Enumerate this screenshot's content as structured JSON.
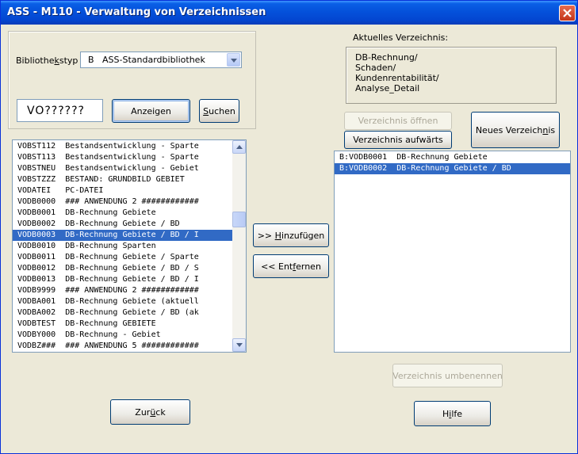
{
  "window": {
    "title": "ASS - M110 - Verwaltung von Verzeichnissen"
  },
  "library": {
    "label": "Bibliothekstyp",
    "label_pre": "Bibliothe",
    "label_acc": "k",
    "label_post": "styp",
    "selected": "B   ASS-Standardbibliothek"
  },
  "search": {
    "value": "VO??????",
    "show_button": "Anzeigen",
    "search_button": "Suchen",
    "search_acc": "S",
    "search_rest": "uchen"
  },
  "source_list": {
    "selected_index": 8,
    "items": [
      "VOBST112  Bestandsentwicklung - Sparte",
      "VOBST113  Bestandsentwicklung - Sparte",
      "VOBSTNEU  Bestandsentwicklung - Gebiet",
      "VOBSTZZZ  BESTAND: GRUNDBILD GEBIET",
      "VODATEI   PC-DATEI",
      "VODB0000  ### ANWENDUNG 2 ############",
      "VODB0001  DB-Rechnung Gebiete",
      "VODB0002  DB-Rechnung Gebiete / BD",
      "VODB0003  DB-Rechnung Gebiete / BD / I",
      "VODB0010  DB-Rechnung Sparten",
      "VODB0011  DB-Rechnung Gebiete / Sparte",
      "VODB0012  DB-Rechnung Gebiete / BD / S",
      "VODB0013  DB-Rechnung Gebiete / BD / I",
      "VODB9999  ### ANWENDUNG 2 ############",
      "VODBA001  DB-Rechnung Gebiete (aktuell",
      "VODBA002  DB-Rechnung Gebiete / BD (ak",
      "VODBTEST  DB-Rechnung GEBIETE",
      "VODBY000  DB-Rechnung - Gebiet",
      "VODBZ###  ### ANWENDUNG 5 ############"
    ]
  },
  "actions": {
    "add": "Hinzufügen",
    "add_prefix": ">> ",
    "add_acc": "H",
    "add_rest": "inzufügen",
    "remove": "Entfernen",
    "remove_prefix": "<< Ent",
    "remove_acc": "f",
    "remove_rest": "ernen"
  },
  "current_dir": {
    "label": "Aktuelles Verzeichnis:",
    "lines": [
      "DB-Rechnung/",
      "Schaden/",
      "Kundenrentabilität/",
      "Analyse_Detail"
    ]
  },
  "dir_buttons": {
    "open": "Verzeichnis öffnen",
    "up": "Verzeichnis aufwärts",
    "new_pre": "Neues Verzeich",
    "new_acc": "n",
    "new_post": "is",
    "rename": "Verzeichnis umbenennen"
  },
  "target_list": {
    "selected_index": 1,
    "items": [
      "B:VODB0001  DB-Rechnung Gebiete",
      "B:VODB0002  DB-Rechnung Gebiete / BD"
    ]
  },
  "footer": {
    "back_pre": "Zur",
    "back_acc": "ü",
    "back_post": "ck",
    "help_pre": "H",
    "help_acc": "i",
    "help_post": "lfe"
  },
  "colors": {
    "selection": "#316ac5",
    "titlebar": "#0553dc",
    "close": "#c4361a"
  }
}
